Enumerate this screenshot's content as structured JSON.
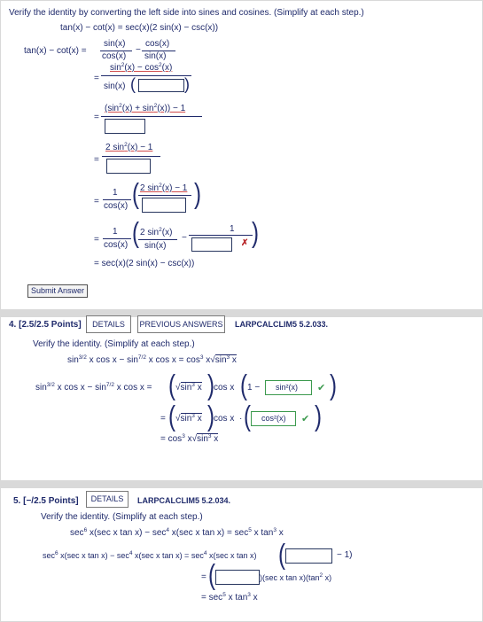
{
  "q3": {
    "instruction": "Verify the identity by converting the left side into sines and cosines. (Simplify at each step.)",
    "identity": "tan(x) − cot(x) = sec(x)(2 sin(x) − csc(x))",
    "lhs": "tan(x) − cot(x) =",
    "s1": {
      "f1_num": "sin(x)",
      "f1_den": "cos(x)",
      "op": "−",
      "f2_num": "cos(x)",
      "f2_den": "sin(x)"
    },
    "s2": {
      "num": "sin²(x) − cos²(x)",
      "den_prefix": "sin(x)"
    },
    "s3": {
      "num": "(sin²(x) + sin²(x)) − 1"
    },
    "s4": {
      "num": "2 sin²(x) − 1"
    },
    "s5": {
      "coef_num": "1",
      "coef_den": "cos(x)",
      "inner_num": "2 sin²(x) − 1"
    },
    "s6": {
      "coef_num": "1",
      "coef_den": "cos(x)",
      "a_num": "2 sin²(x)",
      "a_den": "sin(x)",
      "op": "−",
      "b_num": "1"
    },
    "s7": "= sec(x)(2 sin(x) − csc(x))",
    "submit": "Submit Answer",
    "eq": "="
  },
  "q4": {
    "label": "4. [2.5/2.5 Points]",
    "details": "DETAILS",
    "prev": "PREVIOUS ANSWERS",
    "code": "LARPCALCLIM5 5.2.033.",
    "instruction": "Verify the identity. (Simplify at each step.)",
    "identity_left": "sin3/2 x cos x − sin7/2 x cos x = cos3 x",
    "identity_root": "sin3 x",
    "row1_lhs": "sin3/2 x cos x − sin7/2 x cos x =",
    "root_expr": "sin3 x",
    "cos_x": "cos x",
    "one_minus": "1 −",
    "answer1": "sin²(x)",
    "answer2": "cos²(x)",
    "dot": "·",
    "final": "= cos3 x"
  },
  "q5": {
    "label": "5. [−/2.5 Points]",
    "details": "DETAILS",
    "code": "LARPCALCLIM5 5.2.034.",
    "instruction": "Verify the identity. (Simplify at each step.)",
    "identity": "sec6 x(sec x tan x) − sec4 x(sec x tan x) = sec5 x tan3 x",
    "row1_lhs": "sec6 x(sec x tan x) − sec4 x(sec x tan x) = sec4 x(sec x tan x)",
    "row1_tail": "− 1)",
    "row2_tail": ")(sec x tan x)(tan² x)",
    "row3": "= sec5 x tan3 x"
  }
}
